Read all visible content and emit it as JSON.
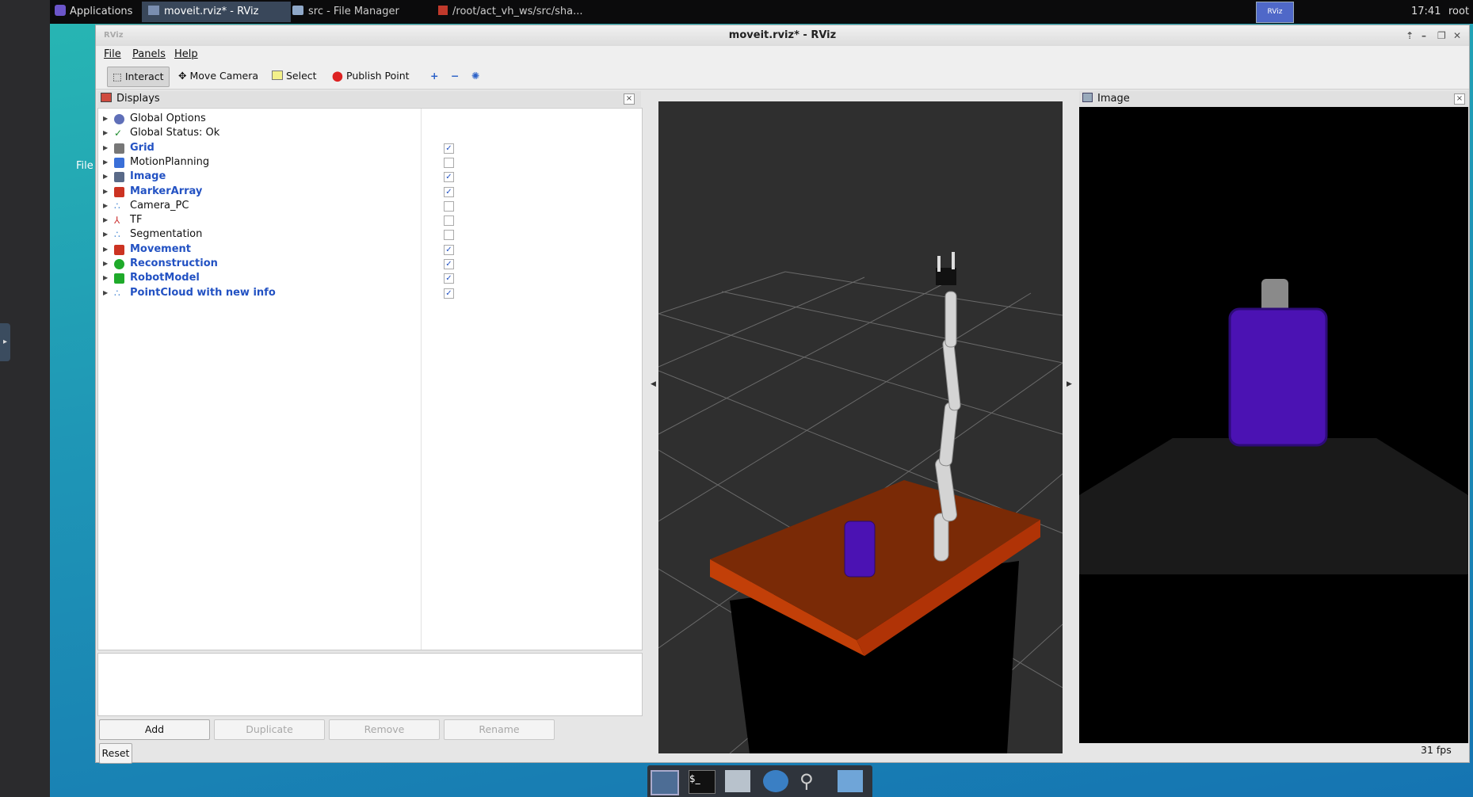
{
  "taskbar": {
    "applications_label": "Applications",
    "tasks": [
      {
        "label": "moveit.rviz* - RViz",
        "active": true
      },
      {
        "label": "src - File Manager",
        "active": false
      },
      {
        "label": "/root/act_vh_ws/src/sha...",
        "active": false
      }
    ],
    "tray_label": "RViz",
    "clock": "17:41",
    "user": "root"
  },
  "desktop": {
    "icon_label": "File"
  },
  "window": {
    "title": "moveit.rviz* - RViz",
    "menu": [
      "File",
      "Panels",
      "Help"
    ],
    "toolbar": {
      "interact": "Interact",
      "move_camera": "Move Camera",
      "select": "Select",
      "publish_point": "Publish Point"
    }
  },
  "displays": {
    "title": "Displays",
    "items": [
      {
        "label": "Global Options",
        "icon": "gear-icon",
        "checkbox": null,
        "bold": false
      },
      {
        "label": "Global Status: Ok",
        "icon": "check-icon",
        "checkbox": null,
        "bold": false
      },
      {
        "label": "Grid",
        "icon": "grid-icon",
        "checkbox": true,
        "bold": true
      },
      {
        "label": "MotionPlanning",
        "icon": "motion-planning-icon",
        "checkbox": false,
        "bold": false
      },
      {
        "label": "Image",
        "icon": "image-icon",
        "checkbox": true,
        "bold": true
      },
      {
        "label": "MarkerArray",
        "icon": "marker-array-icon",
        "checkbox": true,
        "bold": true
      },
      {
        "label": "Camera_PC",
        "icon": "pointcloud-icon",
        "checkbox": false,
        "bold": false
      },
      {
        "label": "TF",
        "icon": "tf-axes-icon",
        "checkbox": false,
        "bold": false
      },
      {
        "label": "Segmentation",
        "icon": "pointcloud-icon",
        "checkbox": false,
        "bold": false
      },
      {
        "label": "Movement",
        "icon": "marker-array-icon",
        "checkbox": true,
        "bold": true
      },
      {
        "label": "Reconstruction",
        "icon": "sphere-icon",
        "checkbox": true,
        "bold": true
      },
      {
        "label": "RobotModel",
        "icon": "robot-model-icon",
        "checkbox": true,
        "bold": true
      },
      {
        "label": "PointCloud with new info",
        "icon": "pointcloud-icon",
        "checkbox": true,
        "bold": true
      }
    ],
    "buttons": {
      "add": "Add",
      "duplicate": "Duplicate",
      "remove": "Remove",
      "rename": "Rename"
    }
  },
  "image_panel": {
    "title": "Image"
  },
  "status": {
    "reset": "Reset",
    "fps": "31 fps"
  },
  "colors": {
    "selected_text": "#2352c3",
    "viewport_bg": "#2f2f2f",
    "table_orange": "#c03a06",
    "object_purple": "#4b12b3"
  }
}
